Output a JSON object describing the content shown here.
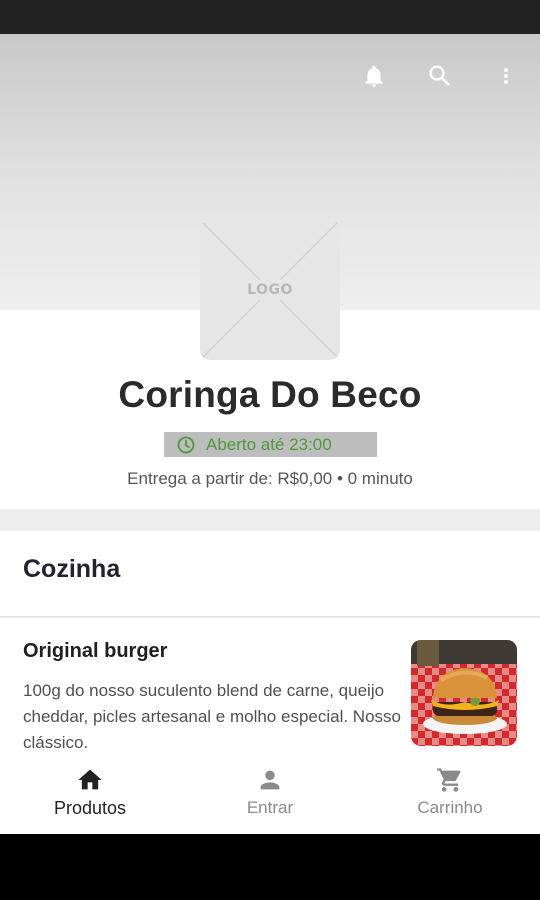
{
  "header": {
    "icons": [
      "bell-icon",
      "search-icon",
      "more-vertical-icon"
    ]
  },
  "store": {
    "logo_text": "LOGO",
    "name": "Coringa Do Beco",
    "status": "Aberto até 23:00",
    "status_color": "#4e9a3c",
    "delivery_info": "Entrega a partir de: R$0,00 • 0 minuto"
  },
  "category": {
    "title": "Cozinha"
  },
  "product": {
    "name": "Original burger",
    "description": "100g do nosso suculento blend de carne, queijo cheddar, picles artesanal e molho especial. Nosso clássico."
  },
  "bottom_nav": {
    "items": [
      {
        "label": "Produtos",
        "icon": "home-icon",
        "active": true
      },
      {
        "label": "Entrar",
        "icon": "person-icon",
        "active": false
      },
      {
        "label": "Carrinho",
        "icon": "cart-icon",
        "active": false
      }
    ]
  }
}
